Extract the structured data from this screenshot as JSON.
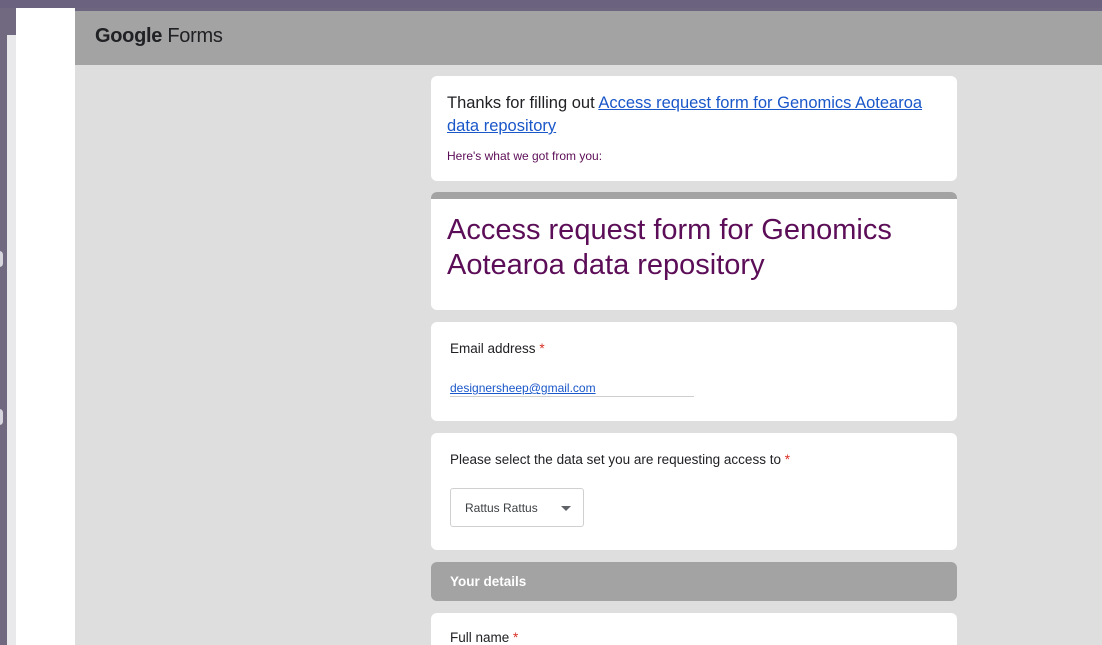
{
  "header": {
    "logo_google": "Google",
    "logo_forms": "Forms"
  },
  "confirmation": {
    "thanks_prefix": "Thanks for filling out ",
    "form_link": "Access request form for Genomics Aotearoa data repository",
    "summary_intro": "Here's what we got from you:"
  },
  "form": {
    "title": "Access request form for Genomics Aotearoa data repository"
  },
  "questions": {
    "email": {
      "label": "Email address",
      "required_mark": "*",
      "value": "designersheep@gmail.com"
    },
    "dataset": {
      "label": "Please select the data set you are requesting access to",
      "required_mark": "*",
      "selected": "Rattus Rattus"
    },
    "full_name": {
      "label": "Full name",
      "required_mark": "*"
    }
  },
  "section": {
    "title": "Your details"
  },
  "colors": {
    "header_bar": "#a3a3a3",
    "page_background": "#dedede",
    "title_purple": "#5c0d57",
    "link_blue": "#1a57c9",
    "required_red": "#d93025"
  }
}
